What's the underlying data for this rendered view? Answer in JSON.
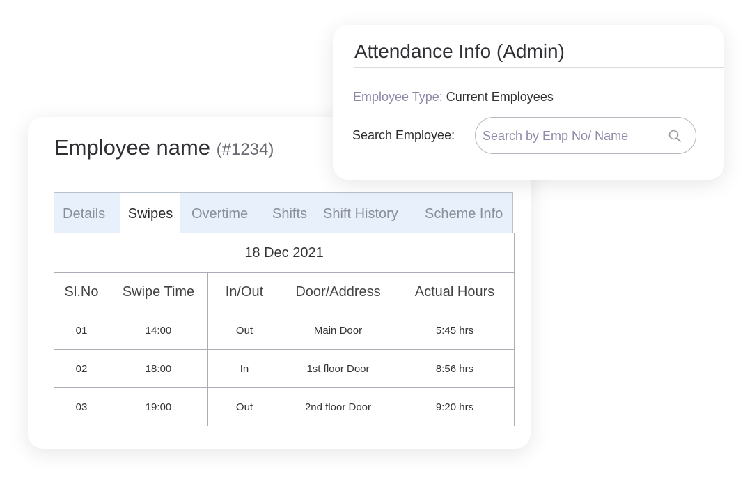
{
  "employee": {
    "name": "Employee name",
    "id": "(#1234)"
  },
  "tabs": [
    {
      "label": "Details",
      "active": false
    },
    {
      "label": "Swipes",
      "active": true
    },
    {
      "label": "Overtime",
      "active": false
    },
    {
      "label": "Shifts",
      "active": false
    },
    {
      "label": "Shift History",
      "active": false
    },
    {
      "label": "Scheme Info",
      "active": false
    }
  ],
  "table": {
    "date": "18 Dec 2021",
    "headers": [
      "Sl.No",
      "Swipe Time",
      "In/Out",
      "Door/Address",
      "Actual Hours"
    ],
    "rows": [
      [
        "01",
        "14:00",
        "Out",
        "Main Door",
        "5:45 hrs"
      ],
      [
        "02",
        "18:00",
        "In",
        "1st floor Door",
        "8:56 hrs"
      ],
      [
        "03",
        "19:00",
        "Out",
        "2nd floor Door",
        "9:20 hrs"
      ]
    ]
  },
  "attendance": {
    "title": "Attendance Info (Admin)",
    "employee_type_label": "Employee Type:",
    "employee_type_value": "Current Employees",
    "search_label": "Search Employee:",
    "search_placeholder": "Search by Emp No/ Name",
    "search_value": ""
  },
  "icons": {
    "search": "search-icon"
  }
}
